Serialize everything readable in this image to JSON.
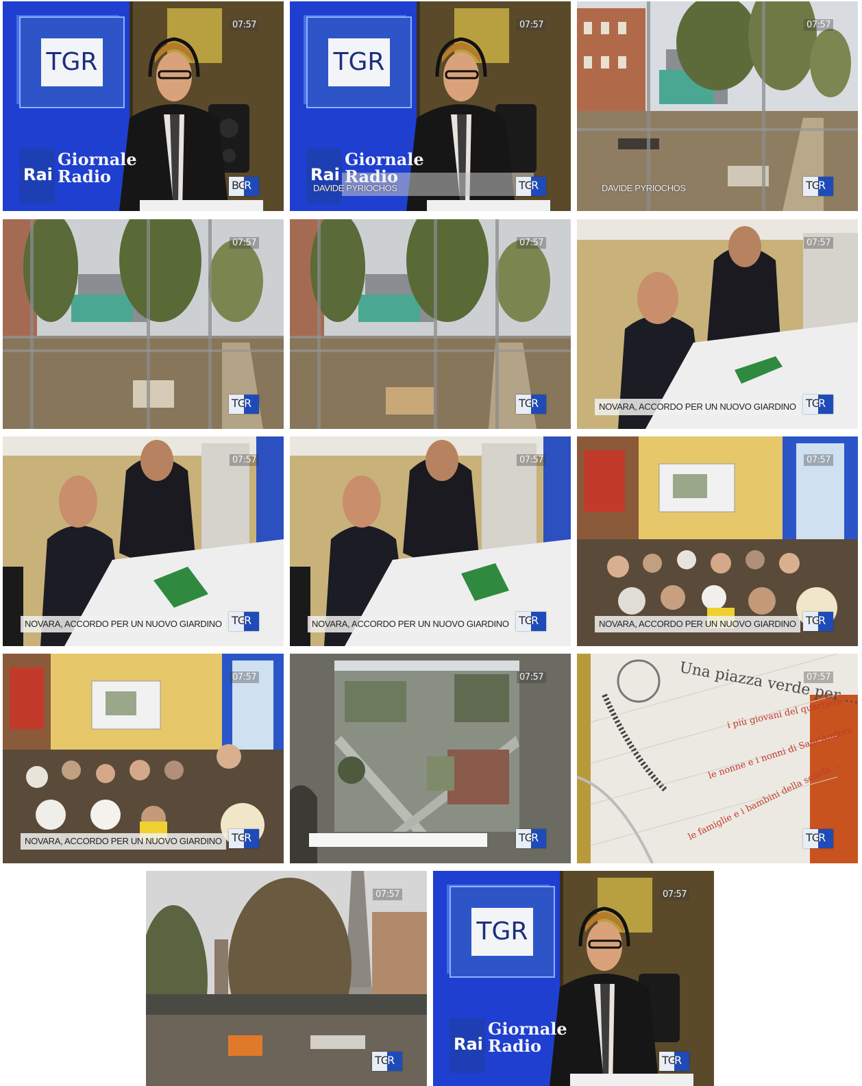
{
  "time": "07:57",
  "logo": {
    "left": "TG",
    "right": "R"
  },
  "frames": [
    {
      "id": "f1",
      "type": "studio",
      "lower": "",
      "studio_logo": "TGR",
      "brand": "Rai",
      "brand_sub": "Giornale Radio",
      "corner_logo_left": "BG"
    },
    {
      "id": "f2",
      "type": "studio",
      "lower": "DAVIDE PYRIOCHOS",
      "studio_logo": "TGR",
      "brand": "Rai",
      "brand_sub": "Giornale Radio"
    },
    {
      "id": "f3",
      "type": "park",
      "lower": "DAVIDE PYRIOCHOS"
    },
    {
      "id": "f4",
      "type": "park-fence",
      "lower": ""
    },
    {
      "id": "f5",
      "type": "park-fence",
      "lower": ""
    },
    {
      "id": "f6",
      "type": "signing",
      "lower": "NOVARA, ACCORDO PER UN NUOVO GIARDINO"
    },
    {
      "id": "f7",
      "type": "signing",
      "lower": "NOVARA, ACCORDO PER UN NUOVO GIARDINO"
    },
    {
      "id": "f8",
      "type": "signing",
      "lower": "NOVARA, ACCORDO PER UN NUOVO GIARDINO"
    },
    {
      "id": "f9",
      "type": "audience",
      "lower": "NOVARA, ACCORDO PER UN NUOVO GIARDINO"
    },
    {
      "id": "f10",
      "type": "audience",
      "lower": "NOVARA, ACCORDO PER UN NUOVO GIARDINO"
    },
    {
      "id": "f11",
      "type": "map",
      "lower": ""
    },
    {
      "id": "f12",
      "type": "banner",
      "lower": ""
    },
    {
      "id": "f13",
      "type": "skyline",
      "lower": ""
    },
    {
      "id": "f14",
      "type": "studio",
      "lower": "",
      "studio_logo": "TGR",
      "brand": "Rai",
      "brand_sub": "Giornale Radio"
    }
  ],
  "banner": {
    "line1": "Una piazza verde per ...",
    "line2": "i più giovani del quartiere",
    "line3": "le nonne e i nonni di Sant'Andrea",
    "line4": "le famiglie e i bambini della scuola ..."
  }
}
